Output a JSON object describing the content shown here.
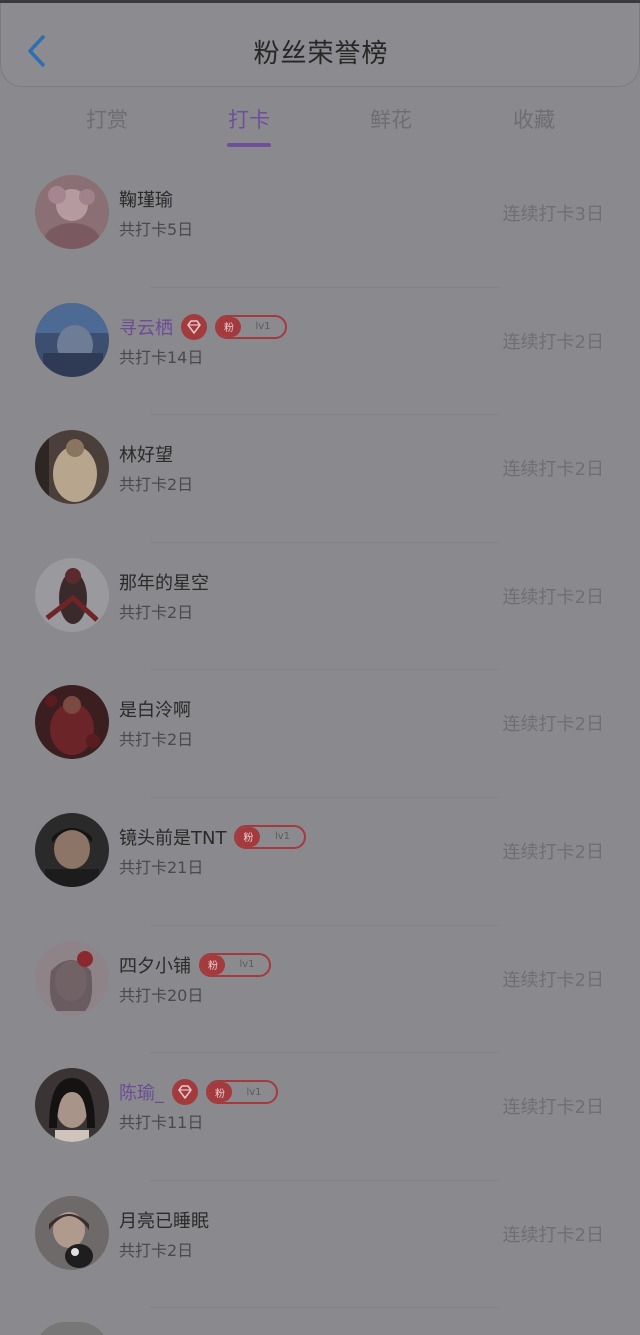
{
  "header": {
    "title": "粉丝荣誉榜",
    "back_icon": "chevron-left-icon",
    "accent_color": "#2f6fb0"
  },
  "tabs": [
    {
      "label": "打赏",
      "active": false
    },
    {
      "label": "打卡",
      "active": true
    },
    {
      "label": "鲜花",
      "active": false
    },
    {
      "label": "收藏",
      "active": false
    }
  ],
  "colors": {
    "active_tab": "#6e4f9a",
    "vip_name": "#6b4c95",
    "badge_red": "#a33a3e"
  },
  "fans": [
    {
      "name": "鞠瑾瑜",
      "total": "共打卡5日",
      "streak": "连续打卡3日",
      "vip": false,
      "gem": false,
      "fan_badge": false
    },
    {
      "name": "寻云栖",
      "total": "共打卡14日",
      "streak": "连续打卡2日",
      "vip": true,
      "gem": true,
      "fan_badge": true,
      "fan_label": "粉",
      "level": "lv1"
    },
    {
      "name": "林好望",
      "total": "共打卡2日",
      "streak": "连续打卡2日",
      "vip": false,
      "gem": false,
      "fan_badge": false
    },
    {
      "name": "那年的星空",
      "total": "共打卡2日",
      "streak": "连续打卡2日",
      "vip": false,
      "gem": false,
      "fan_badge": false
    },
    {
      "name": "是白泠啊",
      "total": "共打卡2日",
      "streak": "连续打卡2日",
      "vip": false,
      "gem": false,
      "fan_badge": false
    },
    {
      "name": "镜头前是TNT",
      "total": "共打卡21日",
      "streak": "连续打卡2日",
      "vip": false,
      "gem": false,
      "fan_badge": true,
      "fan_label": "粉",
      "level": "lv1"
    },
    {
      "name": "四夕小铺",
      "total": "共打卡20日",
      "streak": "连续打卡2日",
      "vip": false,
      "gem": false,
      "fan_badge": true,
      "fan_label": "粉",
      "level": "lv1"
    },
    {
      "name": "陈瑜_",
      "total": "共打卡11日",
      "streak": "连续打卡2日",
      "vip": true,
      "gem": true,
      "fan_badge": true,
      "fan_label": "粉",
      "level": "lv1"
    },
    {
      "name": "月亮已睡眠",
      "total": "共打卡2日",
      "streak": "连续打卡2日",
      "vip": false,
      "gem": false,
      "fan_badge": false
    }
  ]
}
